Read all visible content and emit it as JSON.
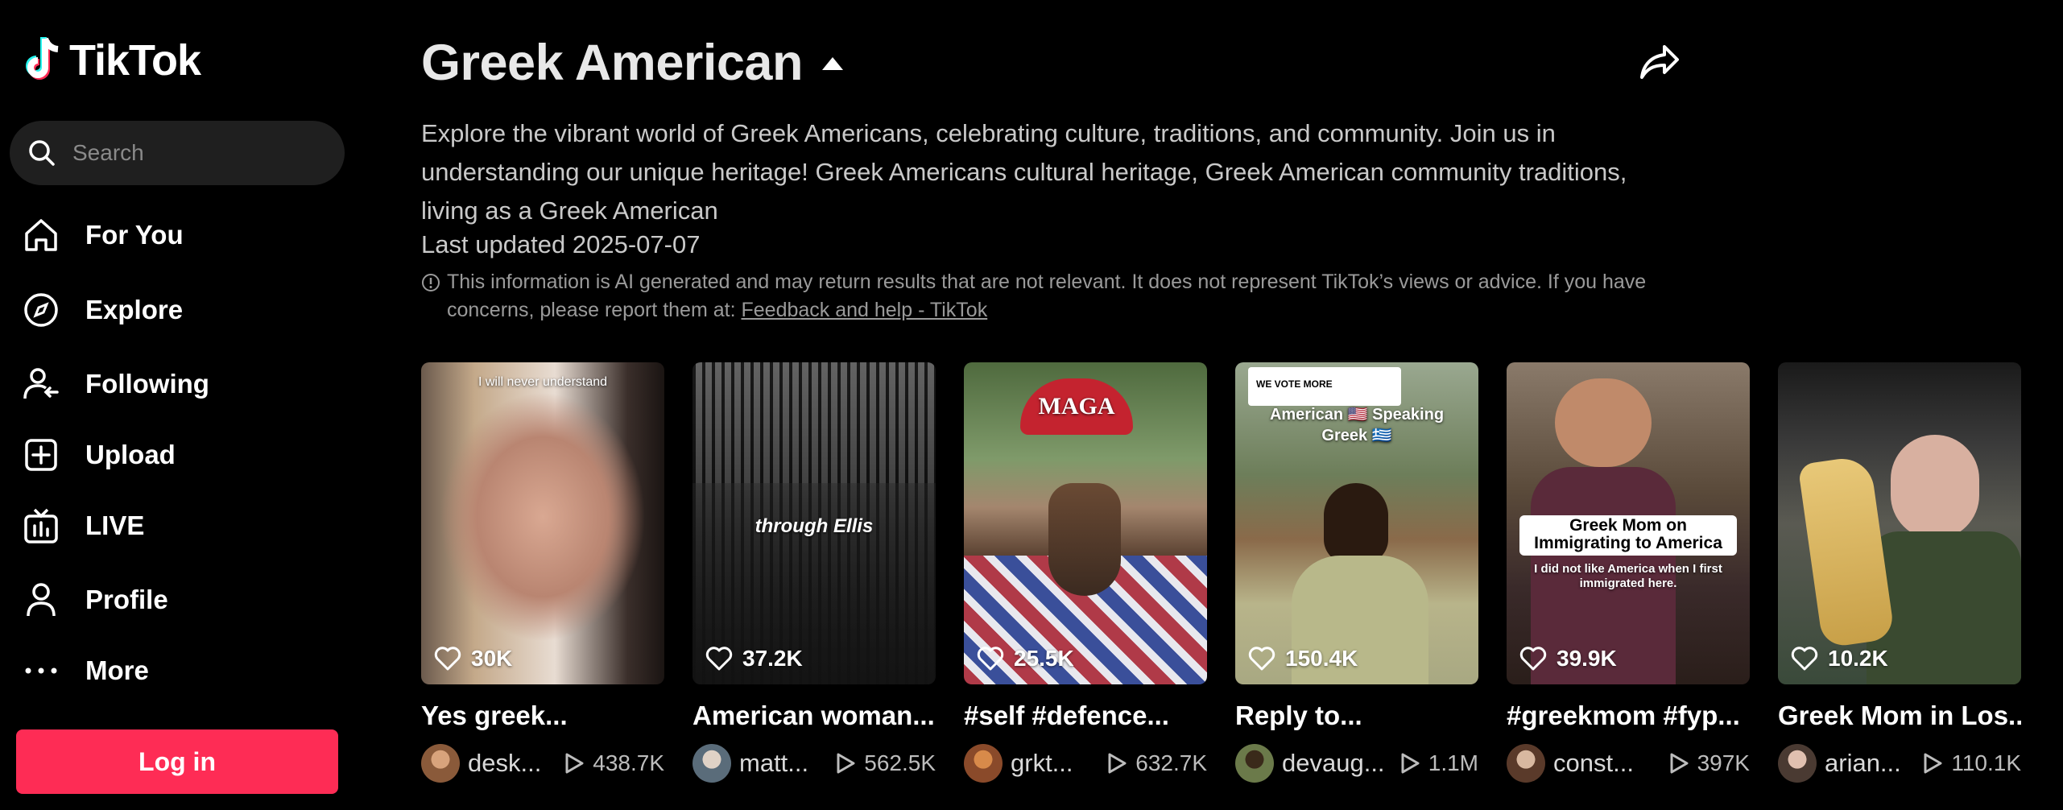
{
  "app": {
    "name": "TikTok",
    "accent": "#fe2c55"
  },
  "search": {
    "placeholder": "Search"
  },
  "nav": [
    {
      "label": "For You",
      "icon": "home-icon"
    },
    {
      "label": "Explore",
      "icon": "compass-icon"
    },
    {
      "label": "Following",
      "icon": "following-icon"
    },
    {
      "label": "Upload",
      "icon": "upload-icon"
    },
    {
      "label": "LIVE",
      "icon": "live-icon"
    },
    {
      "label": "Profile",
      "icon": "profile-icon"
    },
    {
      "label": "More",
      "icon": "more-icon"
    }
  ],
  "login_label": "Log in",
  "topic": {
    "title": "Greek American",
    "description": "Explore the vibrant world of Greek Americans, celebrating culture, traditions, and community. Join us in understanding our unique heritage! Greek Americans cultural heritage, Greek American community traditions, living as a Greek American",
    "updated": "Last updated 2025-07-07",
    "disclaimer": "This information is AI generated and may return results that are not relevant. It does not represent TikTok’s views or advice. If you have concerns, please report them at:",
    "disclaimer_link": "Feedback and help - TikTok"
  },
  "videos": [
    {
      "likes": "30K",
      "caption": "Yes greek...",
      "author": "desk...",
      "views": "438.7K",
      "overlay": "I will never understand"
    },
    {
      "likes": "37.2K",
      "caption": "American woman...",
      "author": "matt...",
      "views": "562.5K",
      "overlay": "through Ellis"
    },
    {
      "likes": "25.5K",
      "caption": "#self #defence...",
      "author": "grkt...",
      "views": "632.7K",
      "overlay": "MAGA"
    },
    {
      "likes": "150.4K",
      "caption": "Reply to...",
      "author": "devaug...",
      "views": "1.1M",
      "overlay": "American 🇺🇸 Speaking Greek 🇬🇷",
      "overlay_top": "WE VOTE MORE"
    },
    {
      "likes": "39.9K",
      "caption": "#greekmom #fyp...",
      "author": "const...",
      "views": "397K",
      "overlay": "Greek Mom on Immigrating to America",
      "overlay_sub": "I did not like America when I first immigrated here."
    },
    {
      "likes": "10.2K",
      "caption": "Greek Mom in Los...",
      "author": "arian...",
      "views": "110.1K",
      "overlay": ""
    }
  ]
}
